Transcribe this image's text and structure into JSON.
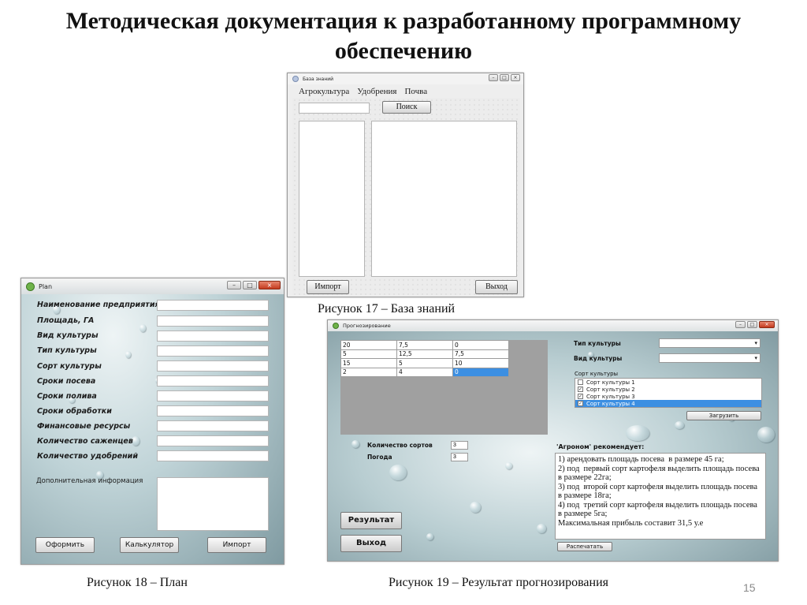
{
  "slide": {
    "title": "Методическая документация к разработанному программному обеспечению",
    "page_number": "15"
  },
  "captions": {
    "fig17": "Рисунок 17 – База знаний",
    "fig18": "Рисунок 18 – План",
    "fig19": "Рисунок 19 – Результат прогнозирования"
  },
  "kb_window": {
    "title": "База знаний",
    "menu": [
      "Агрокультура",
      "Удобрения",
      "Почва"
    ],
    "search_button": "Поиск",
    "import_button": "Импорт",
    "exit_button": "Выход"
  },
  "plan_window": {
    "title": "Plan",
    "fields": [
      "Наименование предприятия",
      "Площадь, ГА",
      "Вид культуры",
      "Тип культуры",
      "Сорт культуры",
      "Сроки посева",
      "Сроки полива",
      "Сроки обработки",
      "Финансовые ресурсы",
      "Количество саженцев",
      "Количество удобрений"
    ],
    "extra_info_label": "Дополнительная информация",
    "buttons": {
      "submit": "Оформить",
      "calculator": "Калькулятор",
      "import": "Импорт"
    }
  },
  "forecast_window": {
    "title": "Прогнозирование",
    "table_rows": [
      [
        "20",
        "7,5",
        "0"
      ],
      [
        "5",
        "12,5",
        "7,5"
      ],
      [
        "15",
        "5",
        "10"
      ],
      [
        "2",
        "4",
        "0"
      ]
    ],
    "culture_type_label": "Тип культуры",
    "culture_kind_label": "Вид культуры",
    "culture_sort_label": "Сорт культуры",
    "sorts": [
      {
        "label": "Сорт культуры 1",
        "checked": false
      },
      {
        "label": "Сорт культуры 2",
        "checked": true
      },
      {
        "label": "Сорт культуры 3",
        "checked": true
      },
      {
        "label": "Сорт культуры 4",
        "checked": true
      }
    ],
    "load_button": "Загрузить",
    "sorts_count_label": "Количество сортов",
    "sorts_count_value": "3",
    "weather_label": "Погода",
    "weather_value": "3",
    "recommend_label": "'Агроном' рекомендует:",
    "recommend_text": "1) арендовать площадь посева  в размере 45 га;\n2) под  первый сорт картофеля выделить площадь посева в размере 22га;\n3) под  второй сорт картофеля выделить площадь посева в размере 18га;\n4) под  третий сорт картофеля выделить площадь посева в размере 5га;\nМаксимальная прибыль составит 31,5 у.е",
    "result_button": "Результат",
    "exit_button": "Выход",
    "print_button": "Распечатать"
  }
}
